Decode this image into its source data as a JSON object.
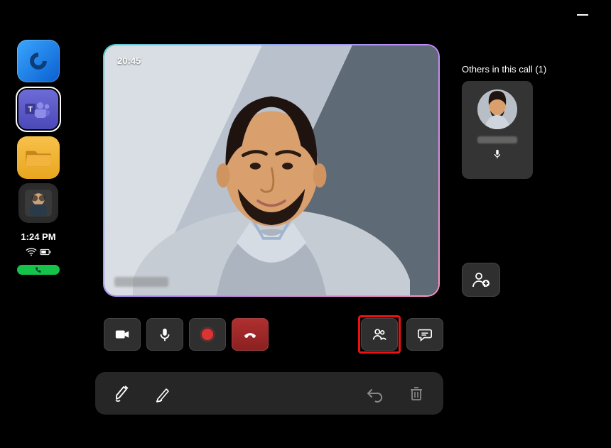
{
  "window": {
    "minimize_symbol": "–"
  },
  "sidebar": {
    "apps": [
      {
        "name": "loop"
      },
      {
        "name": "teams"
      },
      {
        "name": "files"
      },
      {
        "name": "contact-avatar"
      }
    ],
    "clock": "1:24 PM",
    "wifi": true,
    "battery": true,
    "call_active": true
  },
  "video": {
    "timer": "20:45",
    "speaker_name_obscured": true
  },
  "controls": {
    "camera": "camera",
    "mic": "microphone",
    "record": "record",
    "hangup": "hang-up",
    "people": "people",
    "chat": "chat"
  },
  "right_panel": {
    "others_label": "Others in this call (1)",
    "participant_count": 1,
    "participant_mic_on": true,
    "add_person": "add-person"
  },
  "bottom_bar": {
    "marker": "highlighter",
    "pen": "pen",
    "undo": "undo",
    "delete": "delete"
  }
}
